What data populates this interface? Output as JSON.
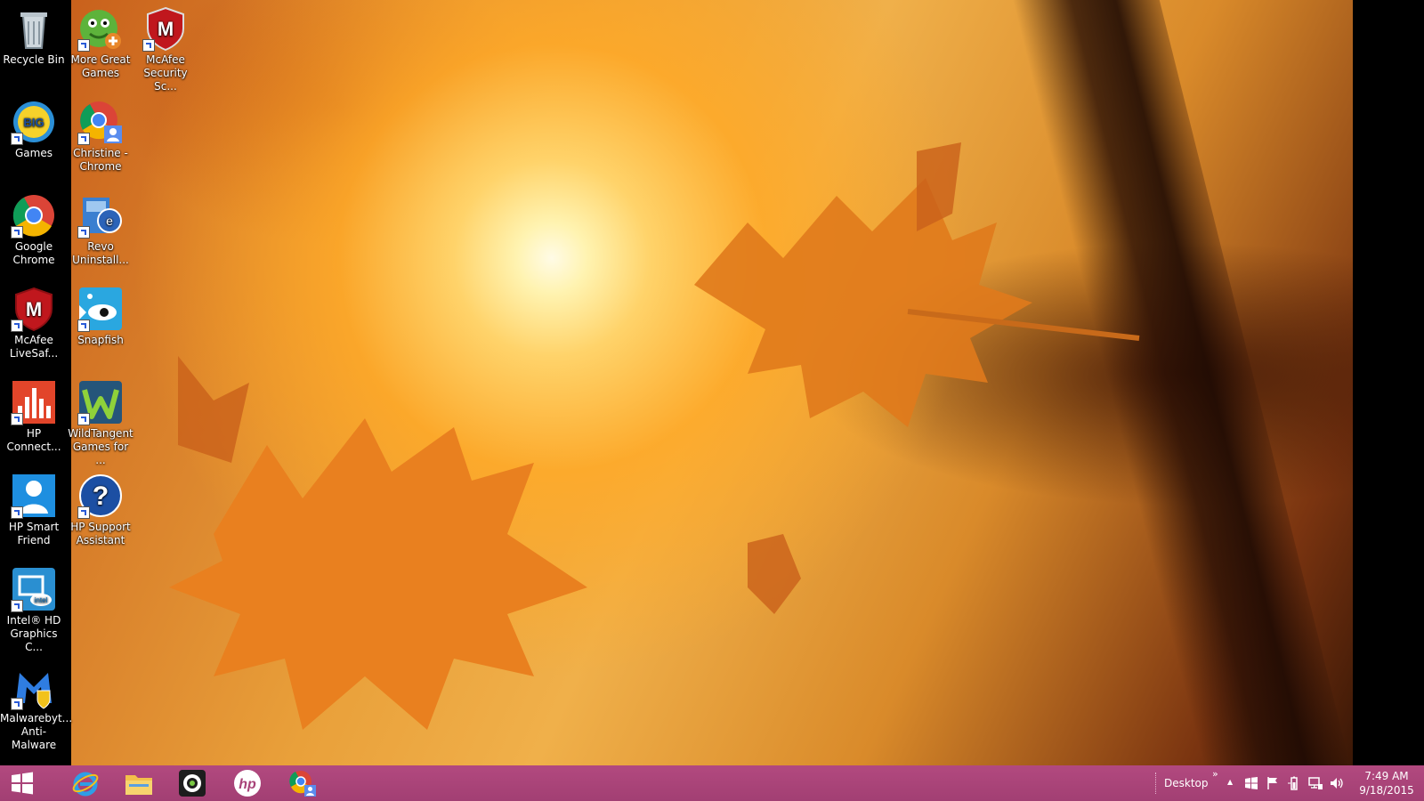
{
  "desktop": {
    "icons": [
      {
        "label": "Recycle Bin",
        "icon": "recycle-bin-icon"
      },
      {
        "label": "More Great Games",
        "icon": "games-icon"
      },
      {
        "label": "McAfee Security Sc...",
        "icon": "mcafee-icon"
      },
      {
        "label": "Games",
        "icon": "bigfish-icon"
      },
      {
        "label": "Christine - Chrome",
        "icon": "chrome-user-icon"
      },
      {
        "label": "Google Chrome",
        "icon": "chrome-icon"
      },
      {
        "label": "Revo Uninstall...",
        "icon": "revo-icon"
      },
      {
        "label": "McAfee LiveSaf...",
        "icon": "mcafee-icon"
      },
      {
        "label": "Snapfish",
        "icon": "snapfish-icon"
      },
      {
        "label": "HP Connect...",
        "icon": "hp-connect-icon"
      },
      {
        "label": "WildTangent Games for ...",
        "icon": "wildtangent-icon"
      },
      {
        "label": "HP Smart Friend",
        "icon": "hp-smart-friend-icon"
      },
      {
        "label": "HP Support Assistant",
        "icon": "help-icon"
      },
      {
        "label": "Intel® HD Graphics C...",
        "icon": "intel-icon"
      },
      {
        "label": "Malwarebyt... Anti-Malware",
        "icon": "malwarebytes-icon"
      }
    ]
  },
  "taskbar": {
    "pinned": [
      "windows-start-icon",
      "internet-explorer-icon",
      "file-explorer-icon",
      "media-icon",
      "hp-icon",
      "chrome-user-icon"
    ],
    "toolbar_label": "Desktop",
    "toolbar_chevron": "»",
    "tray_expand": "▲",
    "time": "7:49 AM",
    "date": "9/18/2015"
  },
  "colors": {
    "taskbar": "#a84378",
    "wallpaper_accent": "#e9a03a"
  }
}
